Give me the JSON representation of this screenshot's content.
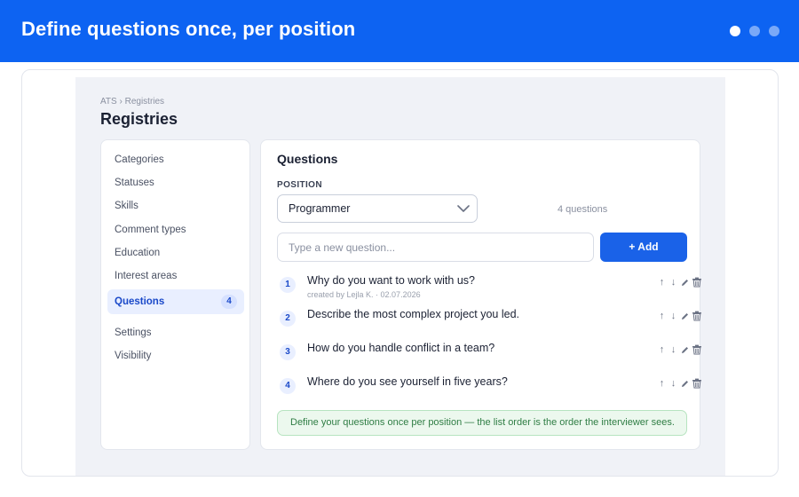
{
  "banner": {
    "title": "Define questions once, per position",
    "dots": 3
  },
  "breadcrumb": "ATS › Registries",
  "page_title": "Registries",
  "sidebar": {
    "items": [
      {
        "label": "Categories"
      },
      {
        "label": "Statuses"
      },
      {
        "label": "Skills"
      },
      {
        "label": "Comment types"
      },
      {
        "label": "Education"
      },
      {
        "label": "Interest areas"
      },
      {
        "label": "Questions",
        "badge": "4",
        "active": true
      },
      {
        "label": "Settings"
      },
      {
        "label": "Visibility"
      }
    ]
  },
  "panel": {
    "title": "Questions",
    "position_label": "POSITION",
    "position_value": "Programmer",
    "count": "4 questions",
    "new_placeholder": "Type a new question...",
    "add_label": "+ Add",
    "questions": [
      {
        "num": "1",
        "text": "Why do you want to work with us?",
        "meta": "created by Lejla K. · 02.07.2026"
      },
      {
        "num": "2",
        "text": "Describe the most complex project you led.",
        "meta": ""
      },
      {
        "num": "3",
        "text": "How do you handle conflict in a team?",
        "meta": ""
      },
      {
        "num": "4",
        "text": "Where do you see yourself in five years?",
        "meta": ""
      }
    ],
    "actions": {
      "up": "↑",
      "down": "↓"
    },
    "hint": "Define your questions once per position — the list order is the order the interviewer sees."
  },
  "colors": {
    "accent": "#0d63f2",
    "button": "#1a62e8",
    "active_bg": "#e9efff",
    "hint_bg": "#ecf8ee",
    "hint_text": "#2f7d44"
  }
}
